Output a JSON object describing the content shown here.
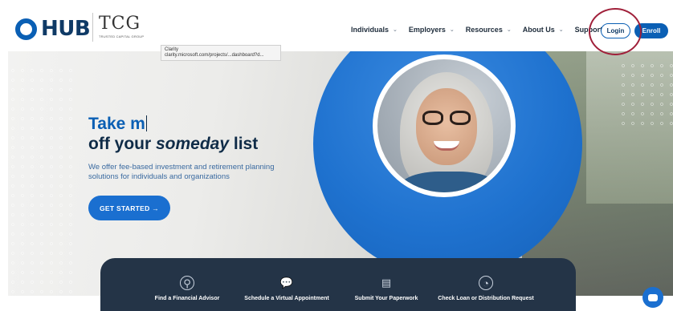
{
  "header": {
    "hub_logo_text": "HUB",
    "tcg_logo_text": "TCG",
    "tcg_logo_subtitle": "TRUSTED CAPITAL GROUP",
    "nav": [
      {
        "label": "Individuals"
      },
      {
        "label": "Employers"
      },
      {
        "label": "Resources"
      },
      {
        "label": "About Us"
      },
      {
        "label": "Support"
      }
    ],
    "login_label": "Login",
    "enroll_label": "Enroll"
  },
  "tooltip": {
    "title": "Clarity",
    "url": "clarity.microsoft.com/projects/...dashboard?d..."
  },
  "hero": {
    "headline_typed": "Take m",
    "headline_line2_prefix": "off your ",
    "headline_line2_emphasis": "someday",
    "headline_line2_suffix": " list",
    "subtext": "We offer fee-based investment and retirement planning solutions for individuals and organizations",
    "cta_label": "GET STARTED →"
  },
  "quick_links": [
    {
      "label": "Find a Financial Advisor",
      "icon": "location-pin-icon"
    },
    {
      "label": "Schedule a Virtual Appointment",
      "icon": "chat-bubbles-icon"
    },
    {
      "label": "Submit Your Paperwork",
      "icon": "documents-icon"
    },
    {
      "label": "Check Loan or Distribution Request",
      "icon": "gauge-icon"
    }
  ],
  "colors": {
    "brand_blue": "#0a5fb4",
    "navy": "#0f2b47",
    "strip_bg": "#243447",
    "highlight_ring": "#a0203a"
  }
}
